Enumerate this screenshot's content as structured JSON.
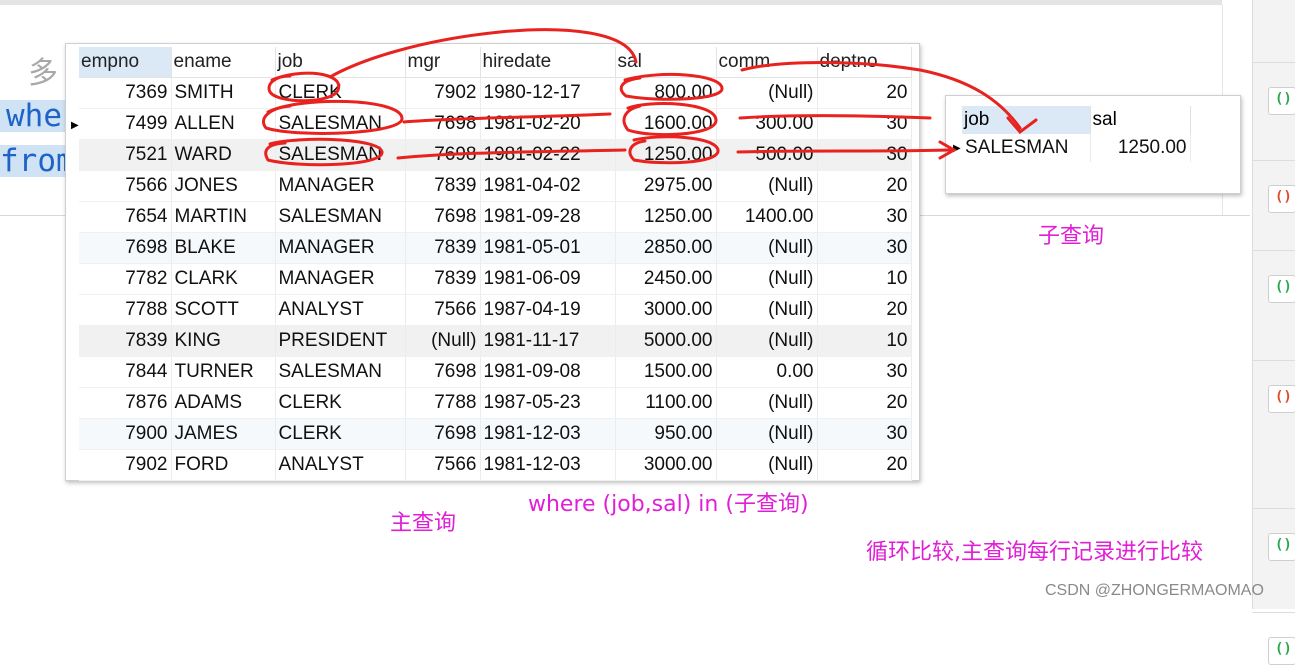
{
  "editor": {
    "faded_char": "多",
    "line1": "whe",
    "line2": "from"
  },
  "grid": {
    "columns": [
      "empno",
      "ename",
      "job",
      "mgr",
      "hiredate",
      "sal",
      "comm",
      "deptno"
    ],
    "rows": [
      [
        "7369",
        "SMITH",
        "CLERK",
        "7902",
        "1980-12-17",
        "800.00",
        "(Null)",
        "20"
      ],
      [
        "7499",
        "ALLEN",
        "SALESMAN",
        "7698",
        "1981-02-20",
        "1600.00",
        "300.00",
        "30"
      ],
      [
        "7521",
        "WARD",
        "SALESMAN",
        "7698",
        "1981-02-22",
        "1250.00",
        "500.00",
        "30"
      ],
      [
        "7566",
        "JONES",
        "MANAGER",
        "7839",
        "1981-04-02",
        "2975.00",
        "(Null)",
        "20"
      ],
      [
        "7654",
        "MARTIN",
        "SALESMAN",
        "7698",
        "1981-09-28",
        "1250.00",
        "1400.00",
        "30"
      ],
      [
        "7698",
        "BLAKE",
        "MANAGER",
        "7839",
        "1981-05-01",
        "2850.00",
        "(Null)",
        "30"
      ],
      [
        "7782",
        "CLARK",
        "MANAGER",
        "7839",
        "1981-06-09",
        "2450.00",
        "(Null)",
        "10"
      ],
      [
        "7788",
        "SCOTT",
        "ANALYST",
        "7566",
        "1987-04-19",
        "3000.00",
        "(Null)",
        "20"
      ],
      [
        "7839",
        "KING",
        "PRESIDENT",
        "(Null)",
        "1981-11-17",
        "5000.00",
        "(Null)",
        "10"
      ],
      [
        "7844",
        "TURNER",
        "SALESMAN",
        "7698",
        "1981-09-08",
        "1500.00",
        "0.00",
        "30"
      ],
      [
        "7876",
        "ADAMS",
        "CLERK",
        "7788",
        "1987-05-23",
        "1100.00",
        "(Null)",
        "20"
      ],
      [
        "7900",
        "JAMES",
        "CLERK",
        "7698",
        "1981-12-03",
        "950.00",
        "(Null)",
        "30"
      ],
      [
        "7902",
        "FORD",
        "ANALYST",
        "7566",
        "1981-12-03",
        "3000.00",
        "(Null)",
        "20"
      ]
    ]
  },
  "subquery": {
    "columns": [
      "job",
      "sal"
    ],
    "rows": [
      [
        "SALESMAN",
        "1250.00"
      ]
    ]
  },
  "annotations": {
    "subquery_label": "子查询",
    "main_label": "主查询",
    "where_label": "where (job,sal) in (子查询)",
    "loop_label": "循环比较,主查询每行记录进行比较"
  },
  "watermark": "CSDN @ZHONGERMAOMAO",
  "colors": {
    "annotation": "#e01fd6",
    "ink": "#e8231f",
    "code": "#1f63c7",
    "null": "#b0b6c4"
  },
  "side_icons": [
    "bracket-icon",
    "bracket-icon",
    "bracket-icon",
    "bracket-icon",
    "bracket-icon",
    "bracket-icon",
    "bracket-icon"
  ]
}
